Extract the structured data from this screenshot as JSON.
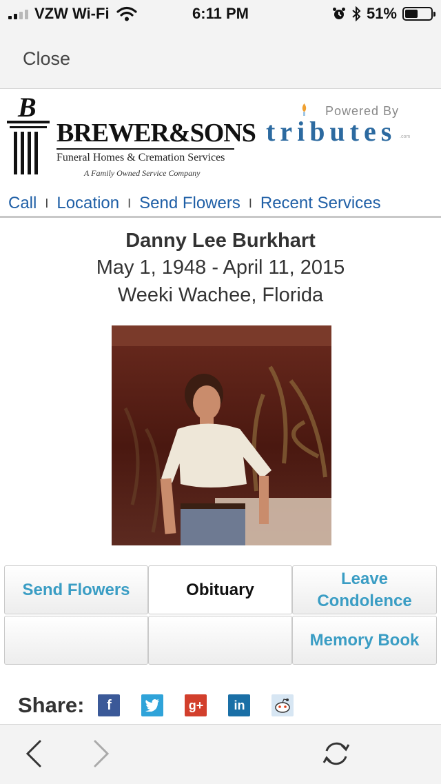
{
  "status_bar": {
    "carrier": "VZW Wi-Fi",
    "time": "6:11 PM",
    "battery_percent": "51%",
    "battery_level": 0.51,
    "icons": [
      "signal-icon",
      "wifi-icon",
      "alarm-icon",
      "bluetooth-icon",
      "battery-icon"
    ]
  },
  "browser": {
    "close_label": "Close"
  },
  "header": {
    "brand_name": "BREWER&SONS",
    "brand_subtitle": "Funeral Homes & Cremation Services",
    "brand_tagline": "A Family Owned Service Company",
    "powered_by": "Powered By",
    "tributes": "tributes",
    "tributes_domain": ".com",
    "accent_color": "#2c6aa0"
  },
  "nav": {
    "items": [
      "Call",
      "Location",
      "Send Flowers",
      "Recent Services"
    ],
    "link_color": "#1f5fa6"
  },
  "obituary": {
    "name": "Danny Lee Burkhart",
    "dates": "May 1, 1948 - April 11, 2015",
    "location": "Weeki Wachee, Florida"
  },
  "tiles": {
    "send_flowers": "Send Flowers",
    "obituary": "Obituary",
    "leave_condolence_line1": "Leave",
    "leave_condolence_line2": "Condolence",
    "memory_book": "Memory Book",
    "accent_color": "#3a9dc4"
  },
  "share": {
    "label": "Share:",
    "networks": [
      "facebook-icon",
      "twitter-icon",
      "google-plus-icon",
      "linkedin-icon",
      "reddit-icon"
    ]
  },
  "toolbar": {
    "icons": [
      "back-icon",
      "forward-icon",
      "refresh-icon"
    ]
  }
}
